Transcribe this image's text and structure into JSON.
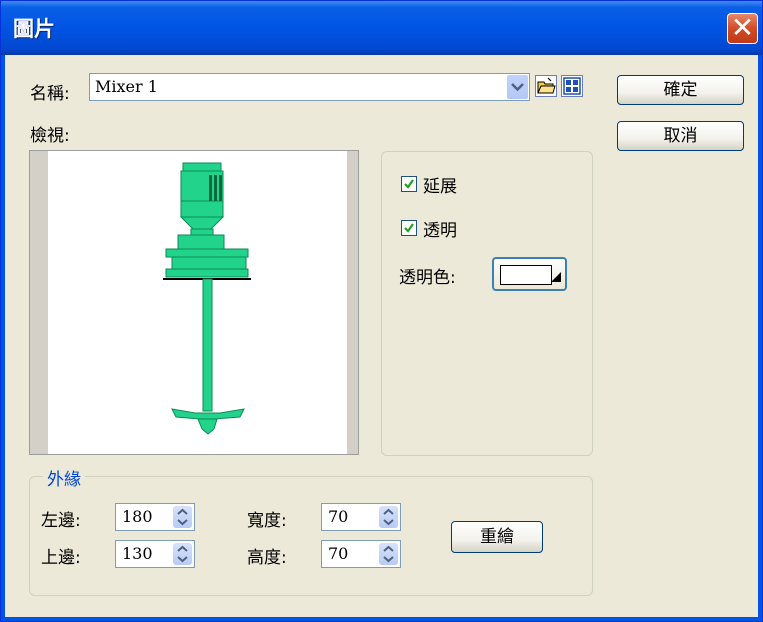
{
  "title": "圖片",
  "name_label": "名稱:",
  "name_value": "Mixer 1",
  "preview_label": "檢視:",
  "ok_label": "確定",
  "cancel_label": "取消",
  "stretch_label": "延展",
  "stretch_checked": true,
  "transparent_label": "透明",
  "transparent_checked": true,
  "transparent_color_label": "透明色:",
  "transparent_color": "#ffffff",
  "border_group_label": "外緣",
  "left_label": "左邊:",
  "left_value": "180",
  "top_label": "上邊:",
  "top_value": "130",
  "width_label": "寬度:",
  "width_value": "70",
  "height_label": "高度:",
  "height_value": "70",
  "redraw_label": "重繪",
  "colors": {
    "titlebar": "#0054e3",
    "dialog_bg": "#ece9d8",
    "accent_group": "#0046d5",
    "mixer_green": "#22d38c"
  },
  "icons": [
    "close-icon",
    "dropdown-arrow-icon",
    "open-folder-icon",
    "grid-icon",
    "checkmark-icon",
    "spin-arrows-icon"
  ]
}
